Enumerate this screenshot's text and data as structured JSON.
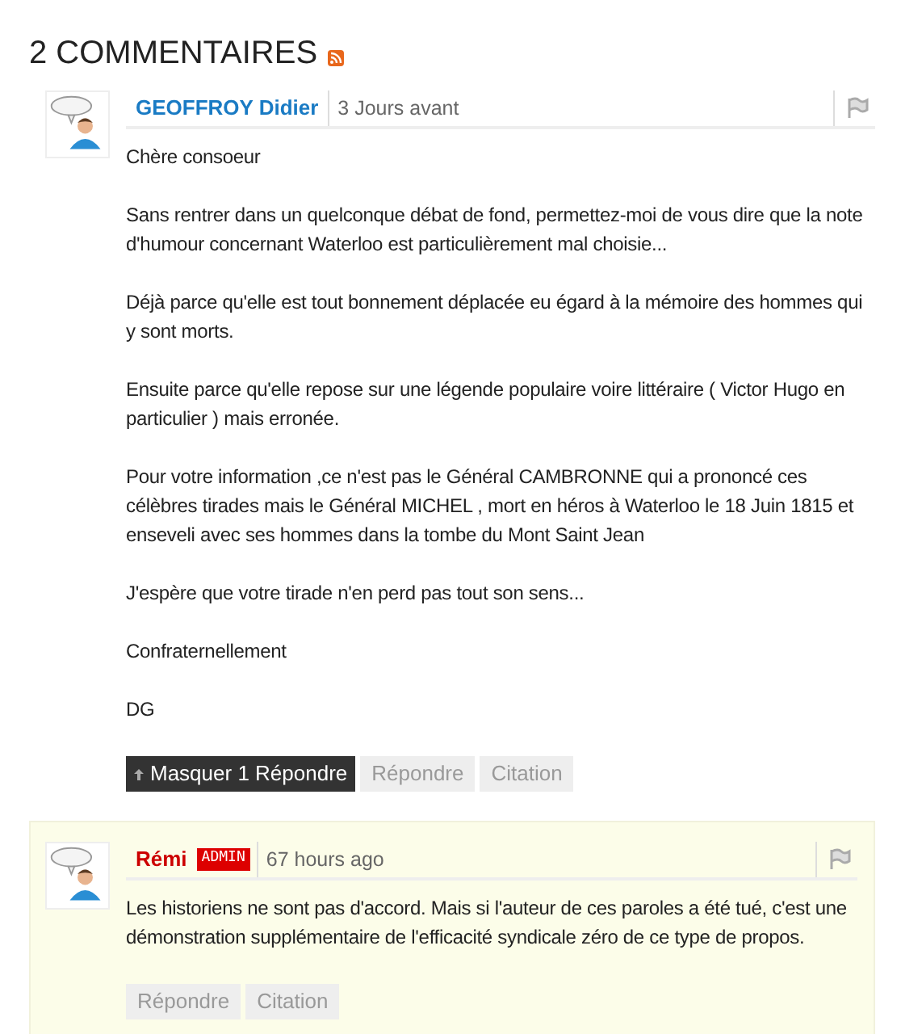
{
  "heading": "2 COMMENTAIRES",
  "comments": [
    {
      "author": "GEOFFROY Didier",
      "time": "3 Jours avant",
      "paragraphs": [
        "Chère consoeur",
        "Sans rentrer dans un quelconque débat de fond, permettez-moi de vous dire que la note d'humour concernant Waterloo est particulièrement mal choisie...",
        "Déjà parce qu'elle est tout bonnement déplacée eu égard à la mémoire des hommes qui y sont morts.",
        "Ensuite parce qu'elle repose sur une légende populaire voire littéraire ( Victor Hugo en particulier ) mais erronée.",
        "Pour votre information ,ce n'est pas le Général CAMBRONNE qui a prononcé ces célèbres tirades mais le Général MICHEL , mort en héros à Waterloo le 18 Juin 1815 et enseveli avec ses hommes dans la tombe du Mont Saint Jean",
        "J'espère que votre tirade n'en perd pas tout son sens...",
        "Confraternellement",
        "DG"
      ],
      "actions": [
        {
          "label": "Masquer 1 Répondre",
          "kind": "toggle"
        },
        {
          "label": "Répondre",
          "kind": "plain"
        },
        {
          "label": "Citation",
          "kind": "plain"
        }
      ],
      "replies": [
        {
          "author": "Rémi",
          "badge": "ADMIN",
          "time": "67 hours ago",
          "paragraphs": [
            "Les historiens ne sont pas d'accord. Mais si l'auteur de ces paroles a été tué, c'est une démonstration supplémentaire de l'efficacité syndicale zéro de ce type de propos."
          ],
          "actions": [
            {
              "label": "Répondre",
              "kind": "plain"
            },
            {
              "label": "Citation",
              "kind": "plain"
            }
          ]
        }
      ]
    }
  ]
}
